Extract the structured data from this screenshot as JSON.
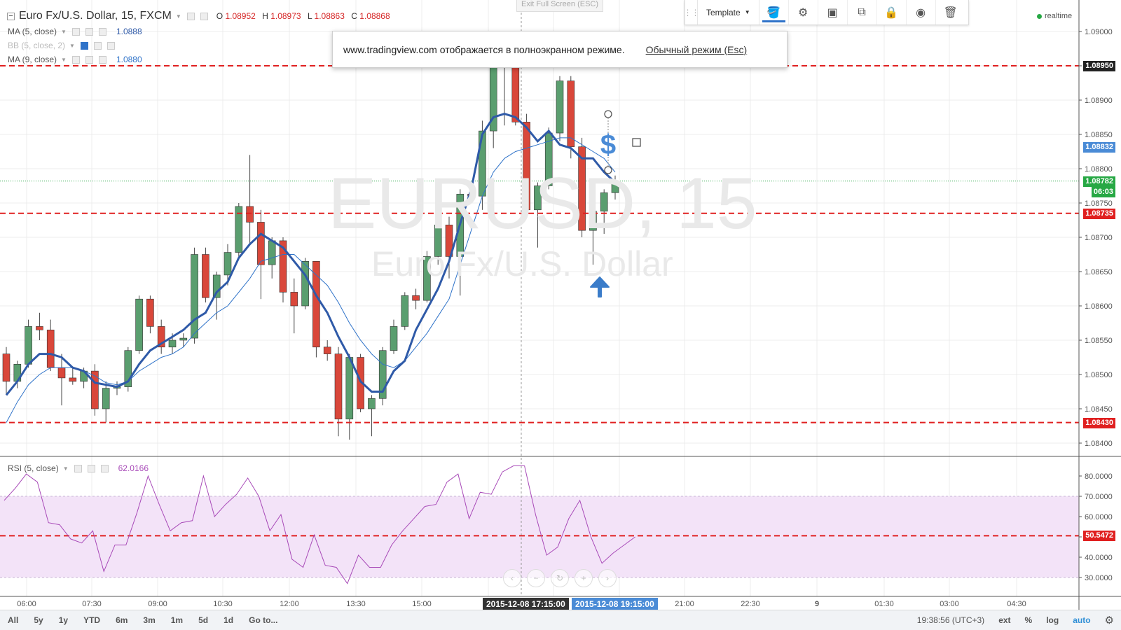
{
  "symbol": {
    "title": "Euro Fx/U.S. Dollar, 15, FXCM",
    "o_label": "O",
    "o": "1.08952",
    "h_label": "H",
    "h": "1.08973",
    "l_label": "L",
    "l": "1.08863",
    "c_label": "C",
    "c": "1.08868"
  },
  "indicators": [
    {
      "name": "MA (5, close)",
      "value": "1.0888",
      "color": "#2f5aa8"
    },
    {
      "name": "BB (5, close, 2)",
      "value": "",
      "color": "#bbbbbb"
    },
    {
      "name": "MA (9, close)",
      "value": "1.0880",
      "color": "#2f73c9"
    }
  ],
  "rsi": {
    "name": "RSI (5, close)",
    "value": "62.0166"
  },
  "watermark": {
    "big": "EURUSD, 15",
    "small": "Euro Fx/U.S. Dollar"
  },
  "exit_fullscreen": "Exit Full Screen (ESC)",
  "fullscreen_popup": {
    "message": "www.tradingview.com отображается в полноэкранном режиме.",
    "link": "Обычный режим (Esc)"
  },
  "toolbar": {
    "template_label": "Template",
    "icons": [
      "paint-bucket-icon",
      "gear-icon",
      "layers-front-icon",
      "clone-icon",
      "lock-icon",
      "eye-icon",
      "trash-icon"
    ]
  },
  "status": {
    "realtime": "realtime"
  },
  "price_axis": {
    "ticks": [
      "1.09000",
      "1.08950",
      "1.08900",
      "1.08850",
      "1.08800",
      "1.08750",
      "1.08700",
      "1.08650",
      "1.08600",
      "1.08550",
      "1.08500",
      "1.08450",
      "1.08400"
    ],
    "labels": [
      {
        "value": "1.08950",
        "price": 1.0895,
        "color": "#222222"
      },
      {
        "value": "1.08832",
        "price": 1.08832,
        "color": "#4a8bd6"
      },
      {
        "value": "1.08782",
        "price": 1.08782,
        "color": "#27a844"
      },
      {
        "value": "06:03",
        "price": 1.08766,
        "color": "#27a844"
      },
      {
        "value": "1.08735",
        "price": 1.08735,
        "color": "#e02020"
      },
      {
        "value": "1.08430",
        "price": 1.0843,
        "color": "#e02020"
      }
    ]
  },
  "rsi_axis": {
    "ticks": [
      "80.0000",
      "70.0000",
      "60.0000",
      "50.0000",
      "40.0000",
      "30.0000"
    ],
    "label": {
      "value": "50.5472",
      "rsi": 50.5472,
      "color": "#e02020"
    }
  },
  "time_axis": {
    "ticks": [
      "06:00",
      "07:30",
      "09:00",
      "10:30",
      "12:00",
      "13:30",
      "15:00",
      "21:00",
      "22:30",
      "9",
      "01:30",
      "03:00",
      "04:30"
    ],
    "highlight_left": "2015-12-08 17:15:00",
    "highlight_right": "2015-12-08 19:15:00"
  },
  "horizontal_lines": [
    1.0895,
    1.08735,
    1.0843
  ],
  "rsi_level": 50.5472,
  "bottom_bar": {
    "ranges": [
      "All",
      "5y",
      "1y",
      "YTD",
      "6m",
      "3m",
      "1m",
      "5d",
      "1d",
      "Go to..."
    ],
    "clock": "19:38:56 (UTC+3)",
    "ext": "ext",
    "pct": "%",
    "log": "log",
    "auto": "auto"
  },
  "colors": {
    "up": "#5a9e6f",
    "down": "#d9473a",
    "ma5": "#2f5aa8",
    "ma9": "#2f73c9",
    "rsi": "#a84ab8",
    "hline": "#e02020"
  },
  "candles": [
    {
      "o": 1.0853,
      "h": 1.0854,
      "l": 1.0847,
      "c": 1.0849
    },
    {
      "o": 1.0849,
      "h": 1.0852,
      "l": 1.0848,
      "c": 1.08515
    },
    {
      "o": 1.08515,
      "h": 1.0858,
      "l": 1.0851,
      "c": 1.0857
    },
    {
      "o": 1.0857,
      "h": 1.0859,
      "l": 1.0855,
      "c": 1.08565
    },
    {
      "o": 1.08565,
      "h": 1.0858,
      "l": 1.08505,
      "c": 1.0851
    },
    {
      "o": 1.0851,
      "h": 1.0853,
      "l": 1.08455,
      "c": 1.08495
    },
    {
      "o": 1.08495,
      "h": 1.0851,
      "l": 1.08485,
      "c": 1.0849
    },
    {
      "o": 1.0849,
      "h": 1.0851,
      "l": 1.0848,
      "c": 1.08505
    },
    {
      "o": 1.08505,
      "h": 1.08515,
      "l": 1.0844,
      "c": 1.0845
    },
    {
      "o": 1.0845,
      "h": 1.0849,
      "l": 1.0843,
      "c": 1.0848
    },
    {
      "o": 1.0848,
      "h": 1.0849,
      "l": 1.0847,
      "c": 1.08482
    },
    {
      "o": 1.08482,
      "h": 1.0854,
      "l": 1.08475,
      "c": 1.08535
    },
    {
      "o": 1.08535,
      "h": 1.08615,
      "l": 1.0853,
      "c": 1.0861
    },
    {
      "o": 1.0861,
      "h": 1.08615,
      "l": 1.0856,
      "c": 1.0857
    },
    {
      "o": 1.0857,
      "h": 1.0858,
      "l": 1.0853,
      "c": 1.0854
    },
    {
      "o": 1.0854,
      "h": 1.0856,
      "l": 1.0853,
      "c": 1.0855
    },
    {
      "o": 1.0855,
      "h": 1.0856,
      "l": 1.0854,
      "c": 1.08553
    },
    {
      "o": 1.08553,
      "h": 1.08685,
      "l": 1.08545,
      "c": 1.08675
    },
    {
      "o": 1.08675,
      "h": 1.08685,
      "l": 1.08605,
      "c": 1.08612
    },
    {
      "o": 1.08612,
      "h": 1.0865,
      "l": 1.0858,
      "c": 1.08645
    },
    {
      "o": 1.08645,
      "h": 1.0869,
      "l": 1.0863,
      "c": 1.08678
    },
    {
      "o": 1.08678,
      "h": 1.0875,
      "l": 1.0867,
      "c": 1.08745
    },
    {
      "o": 1.08745,
      "h": 1.0882,
      "l": 1.0869,
      "c": 1.08722
    },
    {
      "o": 1.08722,
      "h": 1.0874,
      "l": 1.0861,
      "c": 1.0866
    },
    {
      "o": 1.0866,
      "h": 1.087,
      "l": 1.0864,
      "c": 1.08695
    },
    {
      "o": 1.08695,
      "h": 1.087,
      "l": 1.08605,
      "c": 1.0862
    },
    {
      "o": 1.0862,
      "h": 1.0864,
      "l": 1.0856,
      "c": 1.086
    },
    {
      "o": 1.086,
      "h": 1.0867,
      "l": 1.08595,
      "c": 1.08665
    },
    {
      "o": 1.08665,
      "h": 1.08665,
      "l": 1.08525,
      "c": 1.0854
    },
    {
      "o": 1.0854,
      "h": 1.0855,
      "l": 1.0852,
      "c": 1.0853
    },
    {
      "o": 1.0853,
      "h": 1.0854,
      "l": 1.0841,
      "c": 1.08435
    },
    {
      "o": 1.08435,
      "h": 1.0853,
      "l": 1.08405,
      "c": 1.08525
    },
    {
      "o": 1.08525,
      "h": 1.0853,
      "l": 1.08445,
      "c": 1.0845
    },
    {
      "o": 1.0845,
      "h": 1.0847,
      "l": 1.0841,
      "c": 1.08465
    },
    {
      "o": 1.08465,
      "h": 1.0854,
      "l": 1.08455,
      "c": 1.08535
    },
    {
      "o": 1.08535,
      "h": 1.0858,
      "l": 1.0853,
      "c": 1.0857
    },
    {
      "o": 1.0857,
      "h": 1.0862,
      "l": 1.08565,
      "c": 1.08615
    },
    {
      "o": 1.08615,
      "h": 1.08625,
      "l": 1.08595,
      "c": 1.08608
    },
    {
      "o": 1.08608,
      "h": 1.0868,
      "l": 1.08605,
      "c": 1.08672
    },
    {
      "o": 1.08672,
      "h": 1.08725,
      "l": 1.0866,
      "c": 1.08718
    },
    {
      "o": 1.08718,
      "h": 1.0873,
      "l": 1.0864,
      "c": 1.08672
    },
    {
      "o": 1.08672,
      "h": 1.0877,
      "l": 1.08615,
      "c": 1.08763
    },
    {
      "o": 1.08763,
      "h": 1.0877,
      "l": 1.08755,
      "c": 1.0876
    },
    {
      "o": 1.0876,
      "h": 1.0887,
      "l": 1.0874,
      "c": 1.08855
    },
    {
      "o": 1.08855,
      "h": 1.08965,
      "l": 1.0883,
      "c": 1.08955
    },
    {
      "o": 1.08955,
      "h": 1.08973,
      "l": 1.08863,
      "c": 1.0896
    },
    {
      "o": 1.0896,
      "h": 1.08973,
      "l": 1.08863,
      "c": 1.08868
    },
    {
      "o": 1.08868,
      "h": 1.0888,
      "l": 1.0873,
      "c": 1.0874
    },
    {
      "o": 1.0874,
      "h": 1.0878,
      "l": 1.08685,
      "c": 1.08775
    },
    {
      "o": 1.08775,
      "h": 1.0886,
      "l": 1.0877,
      "c": 1.08852
    },
    {
      "o": 1.08852,
      "h": 1.08935,
      "l": 1.0884,
      "c": 1.08928
    },
    {
      "o": 1.08928,
      "h": 1.08935,
      "l": 1.08815,
      "c": 1.08832
    },
    {
      "o": 1.08832,
      "h": 1.08845,
      "l": 1.087,
      "c": 1.0871
    },
    {
      "o": 1.0871,
      "h": 1.08745,
      "l": 1.0866,
      "c": 1.08738
    },
    {
      "o": 1.08738,
      "h": 1.0877,
      "l": 1.08705,
      "c": 1.08765
    },
    {
      "o": 1.08765,
      "h": 1.0879,
      "l": 1.08755,
      "c": 1.08782
    }
  ],
  "ma5": [
    1.0847,
    1.0849,
    1.08515,
    1.0853,
    1.0853,
    1.08525,
    1.0851,
    1.08505,
    1.08488,
    1.08485,
    1.08482,
    1.0849,
    1.08515,
    1.08535,
    1.08545,
    1.08555,
    1.08565,
    1.0858,
    1.0859,
    1.0862,
    1.08635,
    1.0867,
    1.0869,
    1.08705,
    1.08695,
    1.08685,
    1.08665,
    1.08645,
    1.08615,
    1.0859,
    1.08555,
    1.08525,
    1.0849,
    1.08475,
    1.08475,
    1.08505,
    1.0852,
    1.08565,
    1.08595,
    1.08625,
    1.08665,
    1.0872,
    1.0877,
    1.0885,
    1.08875,
    1.0888,
    1.08875,
    1.0886,
    1.0884,
    1.08855,
    1.08835,
    1.0883,
    1.08815,
    1.08815,
    1.08795,
    1.0878
  ],
  "ma9": [
    1.0843,
    1.0846,
    1.08485,
    1.085,
    1.0851,
    1.0851,
    1.0851,
    1.08505,
    1.08498,
    1.08488,
    1.08485,
    1.0849,
    1.08505,
    1.08515,
    1.08525,
    1.0853,
    1.0854,
    1.0856,
    1.08575,
    1.0859,
    1.086,
    1.0862,
    1.0864,
    1.08665,
    1.0867,
    1.08675,
    1.08675,
    1.0866,
    1.08645,
    1.0863,
    1.08605,
    1.08575,
    1.0855,
    1.0853,
    1.08515,
    1.0851,
    1.0852,
    1.0854,
    1.0856,
    1.08585,
    1.0861,
    1.0866,
    1.0871,
    1.0876,
    1.08795,
    1.08815,
    1.08825,
    1.0883,
    1.08835,
    1.0884,
    1.08845,
    1.08845,
    1.08835,
    1.08825,
    1.08815,
    1.08795
  ],
  "rsi_values": [
    68,
    74,
    81,
    77,
    57,
    56,
    49,
    47,
    53,
    33,
    46,
    46,
    62,
    80,
    66,
    53,
    57,
    58,
    80,
    60,
    66,
    71,
    79,
    70,
    53,
    61,
    39,
    35,
    51,
    36,
    35,
    27,
    41,
    35,
    35,
    46,
    53,
    59,
    65,
    66,
    77,
    81,
    59,
    72,
    71,
    82,
    85,
    85,
    61,
    41,
    45,
    59,
    68,
    50,
    37,
    42,
    46,
    50
  ]
}
